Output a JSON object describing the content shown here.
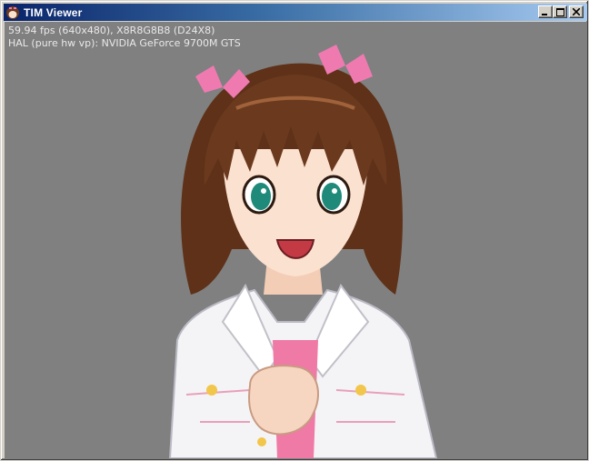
{
  "window": {
    "title": "TIM Viewer",
    "controls": {
      "minimize": "minimize",
      "maximize": "maximize",
      "close": "close"
    }
  },
  "overlay": {
    "line1": "59.94 fps (640x480), X8R8G8B8 (D24X8)",
    "line2": "HAL (pure hw vp): NVIDIA GeForce 9700M GTS"
  },
  "colors": {
    "titlebar_start": "#0a246a",
    "titlebar_end": "#a6caf0",
    "viewport_bg": "#808080",
    "hair": "#6b3a1e",
    "ribbon": "#ef7ab0",
    "eyes": "#1f8a7a",
    "jacket": "#f4f4f6"
  },
  "icons": {
    "app": "character-head-icon"
  }
}
